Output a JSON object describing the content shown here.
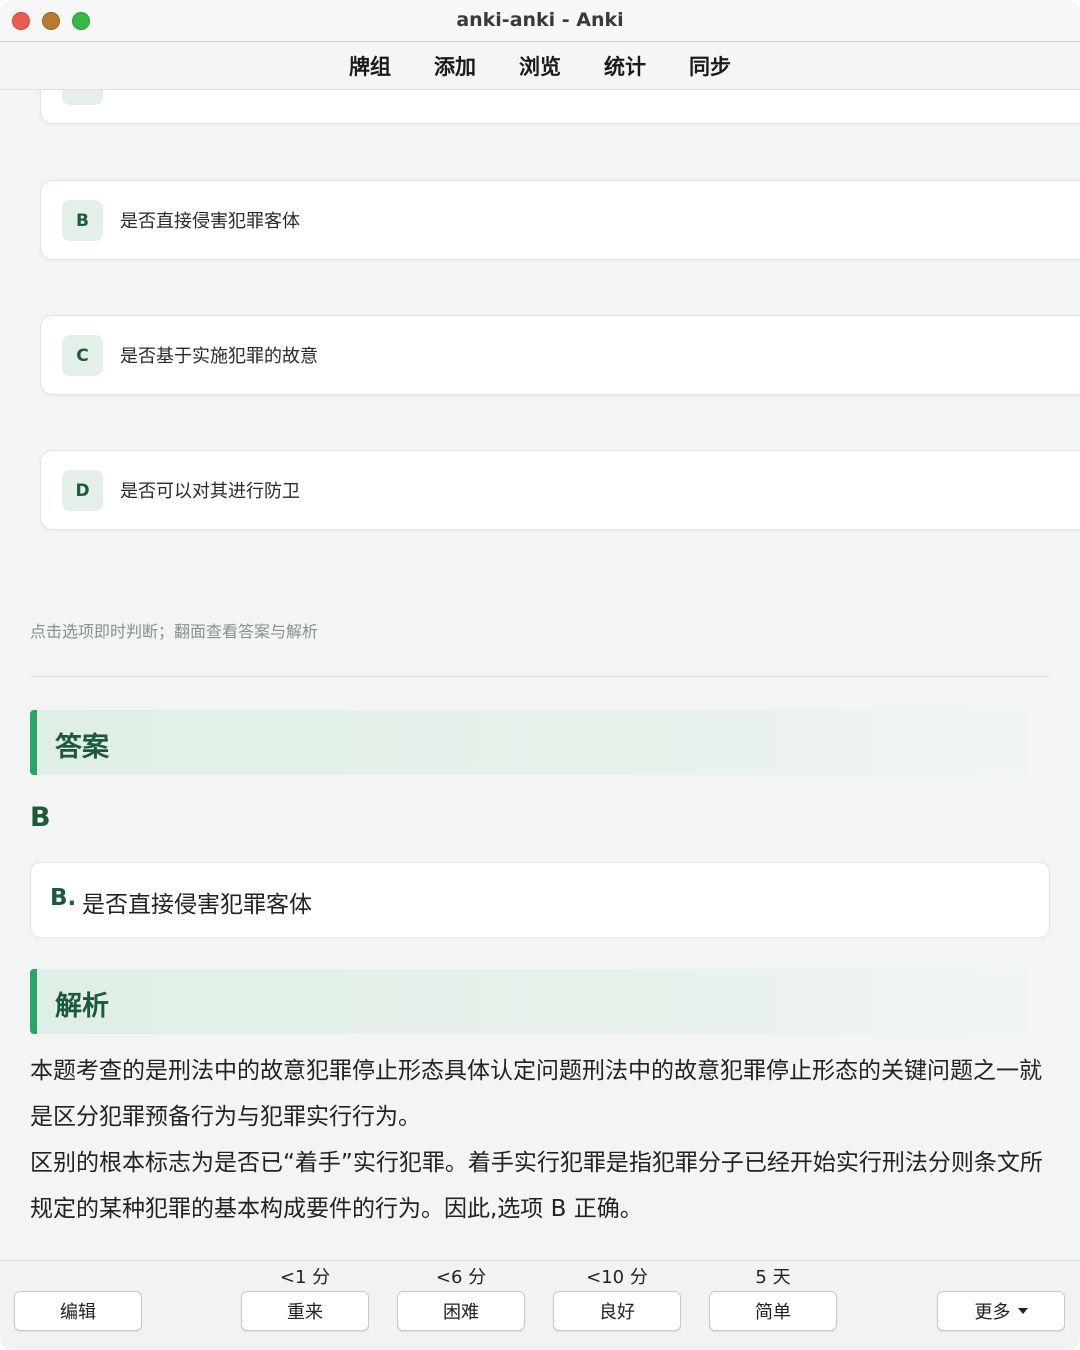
{
  "window": {
    "title": "anki-anki - Anki"
  },
  "toolbar": {
    "items": [
      "牌组",
      "添加",
      "浏览",
      "统计",
      "同步"
    ]
  },
  "card": {
    "options": [
      {
        "letter": "B",
        "text": "是否直接侵害犯罪客体"
      },
      {
        "letter": "C",
        "text": "是否基于实施犯罪的故意"
      },
      {
        "letter": "D",
        "text": "是否可以对其进行防卫"
      }
    ],
    "hint": "点击选项即时判断；翻面查看答案与解析",
    "answer_heading": "答案",
    "answer_letter": "B",
    "answer_box": {
      "prefix": "B.",
      "text": "是否直接侵害犯罪客体"
    },
    "analysis_heading": "解析",
    "analysis_paragraphs": [
      "本题考查的是刑法中的故意犯罪停止形态具体认定问题刑法中的故意犯罪停止形态的关键问题之一就是区分犯罪预备行为与犯罪实行行为。",
      "区别的根本标志为是否已“着手”实行犯罪。着手实行犯罪是指犯罪分子已经开始实行刑法分则条文所规定的某种犯罪的基本构成要件的行为。因此,选项 B 正确。"
    ]
  },
  "bottom": {
    "edit_label": "编辑",
    "more_label": "更多",
    "answers": [
      {
        "interval": "<1 分",
        "label": "重来"
      },
      {
        "interval": "<6 分",
        "label": "困难"
      },
      {
        "interval": "<10 分",
        "label": "良好"
      },
      {
        "interval": "5 天",
        "label": "简单"
      }
    ]
  },
  "colors": {
    "accent": "#2aa364",
    "accent_text": "#1d5a3c",
    "option_badge_bg": "#e3efe8"
  }
}
